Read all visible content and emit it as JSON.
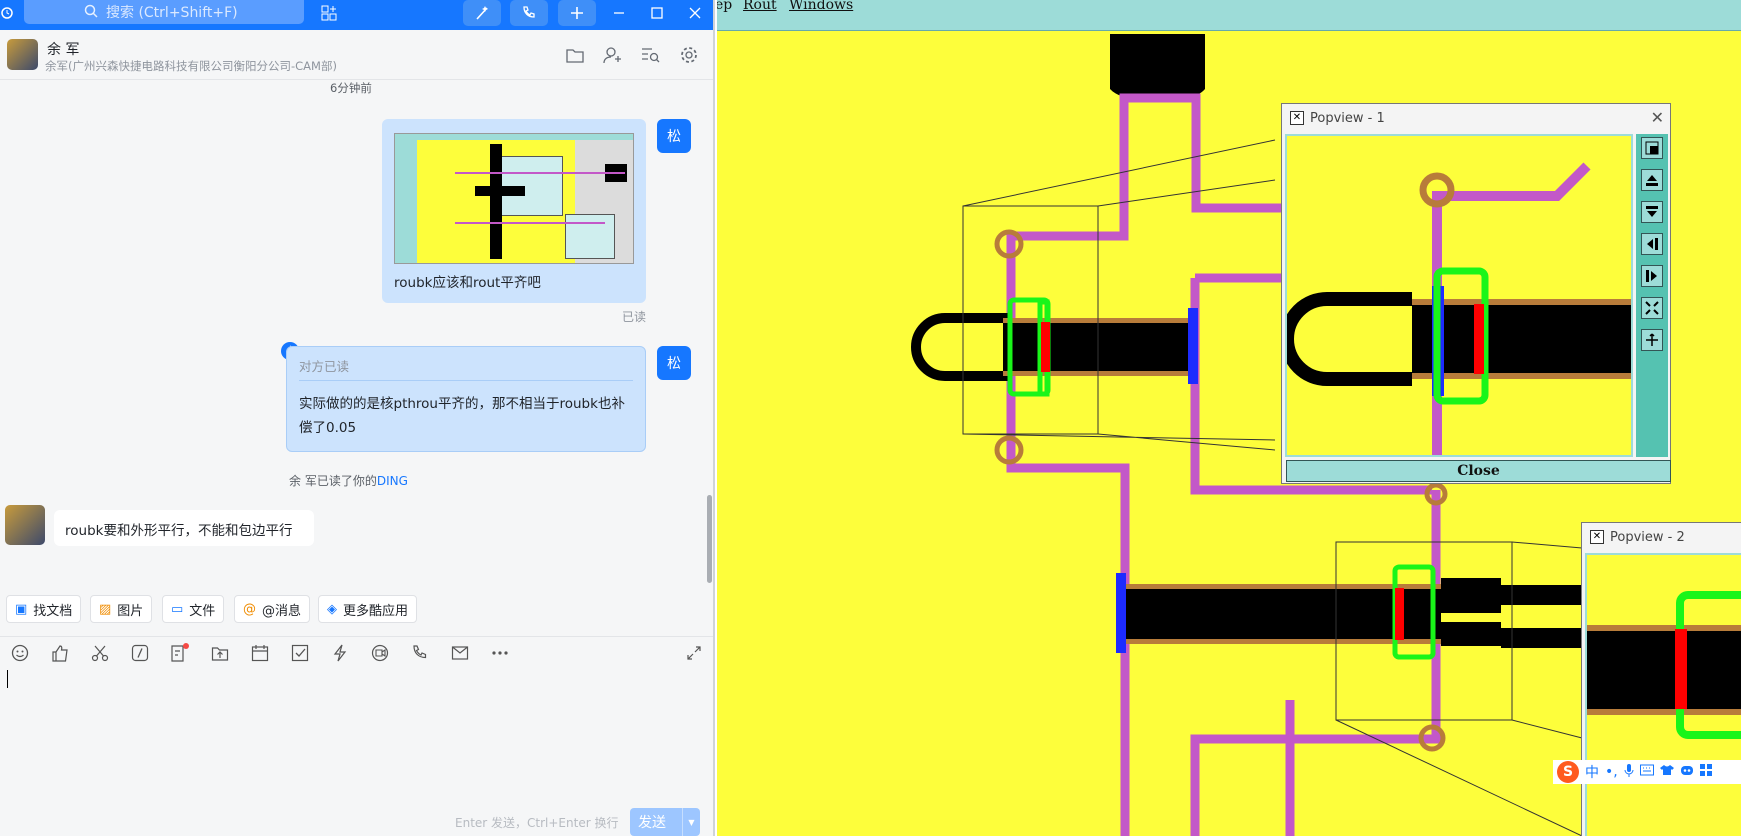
{
  "search": {
    "placeholder": "搜索 (Ctrl+Shift+F)"
  },
  "contact": {
    "name": "余 军",
    "org": "余军(广州兴森快捷电路科技有限公司衡阳分公司-CAM部)"
  },
  "messages": {
    "time_label": "6分钟前",
    "self_avatar": "松",
    "msg1_caption": "roubk应该和rout平齐吧",
    "msg1_status": "已读",
    "msg2_header": "对方已读",
    "msg2_text": "实际做的的是核pthrou平齐的，那不相当于roubk也补偿了0.05",
    "ding_prefix": "余 军已读了你的",
    "ding_link": "DING",
    "msg3_text": "roubk要和外形平行，不能和包边平行"
  },
  "quick_actions": [
    "找文档",
    "图片",
    "文件",
    "@消息",
    "更多酷应用"
  ],
  "compose": {
    "hint": "Enter 发送，Ctrl+Enter 换行",
    "send_label": "发送"
  },
  "cam": {
    "menu": [
      "ep",
      "Rout",
      "Windows"
    ],
    "popview1_title": "Popview - 1",
    "popview2_title": "Popview - 2",
    "close_label": "Close"
  },
  "ime": {
    "lang": "中"
  },
  "colors": {
    "accent": "#1677ff",
    "pcb_bg": "#fdfe3b",
    "trace": "#c358c8",
    "pad_ring": "#19f519",
    "copper": "#b87c3a"
  }
}
